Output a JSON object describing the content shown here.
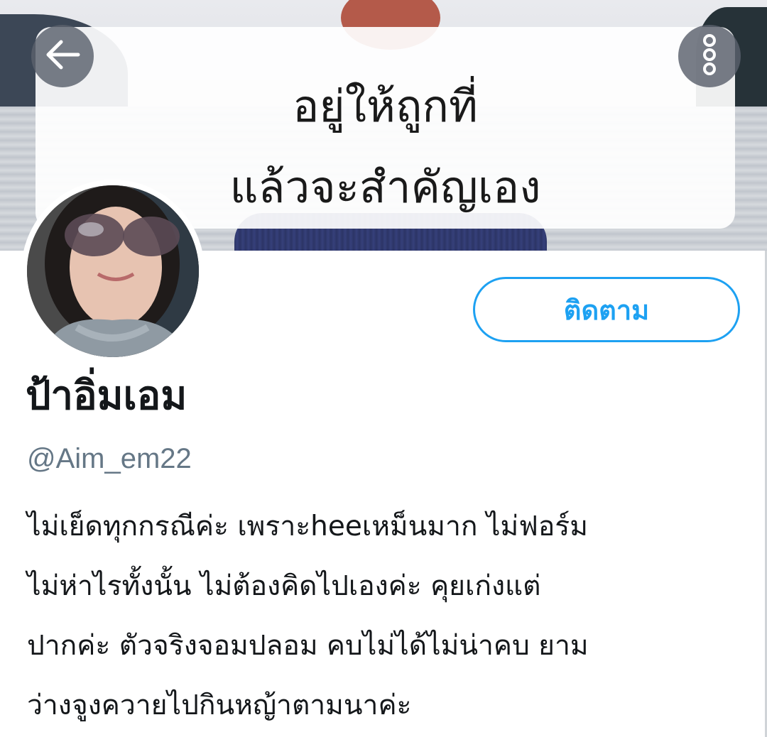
{
  "header": {
    "banner_text_line1": "อยู่ให้ถูกที่",
    "banner_text_line2": "แล้วจะสำคัญเอง",
    "back_icon": "arrow-left-icon",
    "more_icon": "more-vertical-icon"
  },
  "profile": {
    "display_name": "ป้าอิ่มเอม",
    "handle": "@Aim_em22",
    "follow_label": "ติดตาม",
    "bio_lines": [
      "ไม่เย็ดทุกกรณีค่ะ เพราะheeเหม็นมาก ไม่ฟอร์ม",
      "ไม่ห่าไรทั้งนั้น ไม่ต้องคิดไปเองค่ะ คุยเก่งแต่",
      "ปากค่ะ ตัวจริงจอมปลอม คบไม่ได้ไม่น่าคบ ยาม",
      "ว่างจูงควายไปกินหญ้าตามนาค่ะ"
    ]
  },
  "colors": {
    "accent": "#1da1f2",
    "name_text": "#14171a",
    "handle_text": "#657786",
    "overlay_button": "#5a606c"
  }
}
